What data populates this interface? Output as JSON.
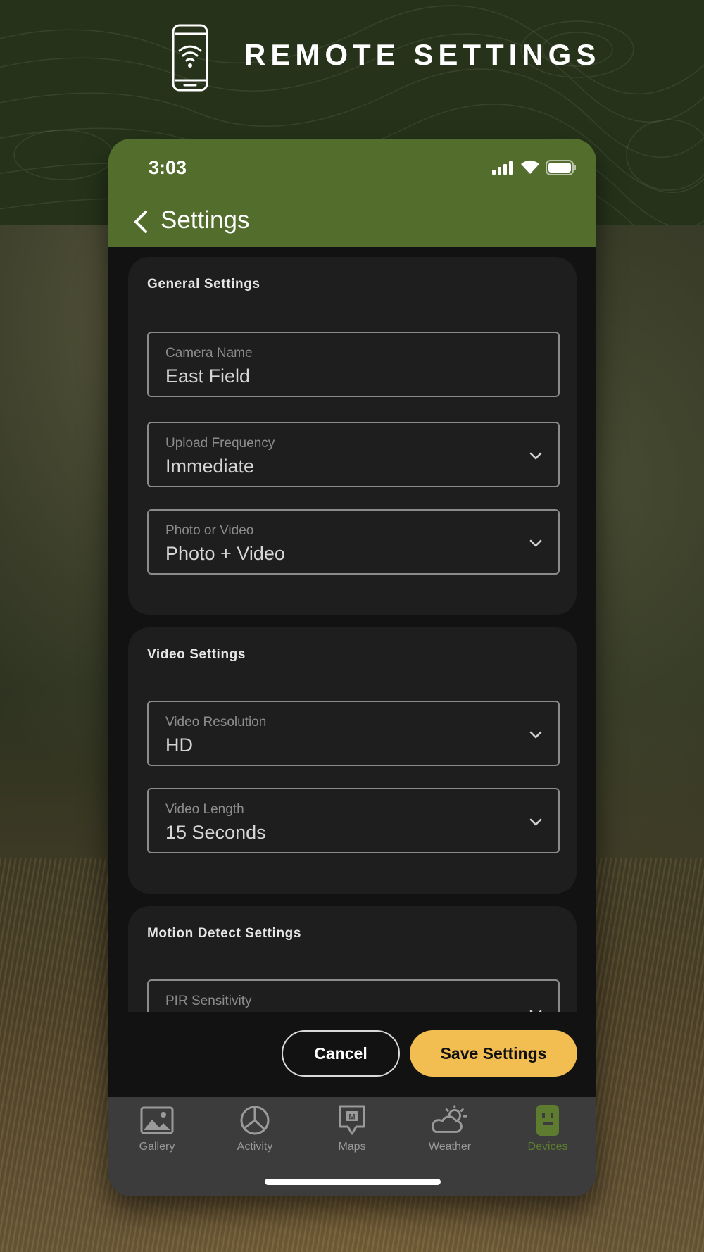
{
  "banner": {
    "title": "REMOTE SETTINGS",
    "icon": "phone-wifi-icon"
  },
  "status_bar": {
    "time": "3:03",
    "icons": [
      "signal-icon",
      "wifi-icon",
      "battery-icon"
    ]
  },
  "app_bar": {
    "title": "Settings",
    "back_icon": "chevron-left-icon",
    "color": "#526d2c"
  },
  "sections": {
    "general": {
      "title": "General Settings",
      "camera_name": {
        "label": "Camera Name",
        "value": "East Field"
      },
      "upload_frequency": {
        "label": "Upload Frequency",
        "value": "Immediate"
      },
      "photo_or_video": {
        "label": "Photo or Video",
        "value": "Photo + Video"
      }
    },
    "video": {
      "title": "Video Settings",
      "resolution": {
        "label": "Video Resolution",
        "value": "HD"
      },
      "length": {
        "label": "Video Length",
        "value": "15 Seconds"
      }
    },
    "motion": {
      "title": "Motion Detect Settings",
      "pir_sensitivity": {
        "label": "PIR Sensitivity",
        "value": ""
      }
    }
  },
  "actions": {
    "cancel": "Cancel",
    "save": "Save Settings",
    "save_color": "#f2bd51"
  },
  "tabs": [
    {
      "label": "Gallery",
      "icon": "image-icon",
      "active": false
    },
    {
      "label": "Activity",
      "icon": "pie-chart-icon",
      "active": false
    },
    {
      "label": "Maps",
      "icon": "map-pin-icon",
      "active": false
    },
    {
      "label": "Weather",
      "icon": "weather-icon",
      "active": false
    },
    {
      "label": "Devices",
      "icon": "trail-camera-icon",
      "active": true
    }
  ],
  "colors": {
    "active_tab": "#5d7c2f",
    "inactive_tab": "#9a9a9a"
  }
}
